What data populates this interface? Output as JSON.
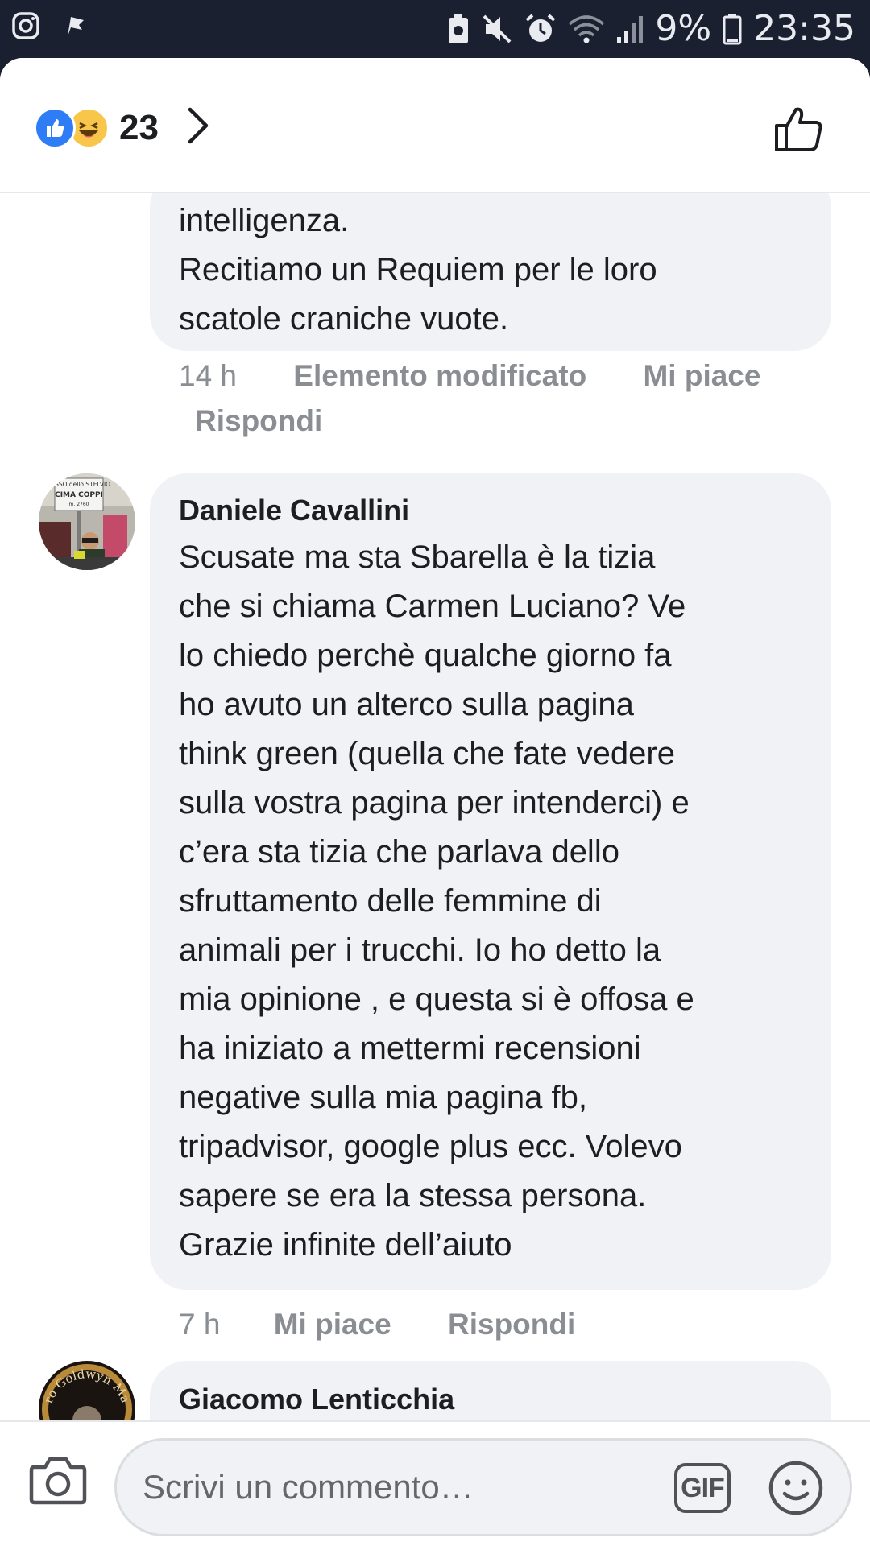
{
  "status_bar": {
    "battery": "9%",
    "time": "23:35"
  },
  "header": {
    "reaction_count": "23"
  },
  "comments": [
    {
      "text": "intelligenza.\nRecitiamo un Requiem per le loro\nscatole craniche vuote.",
      "time": "14 h",
      "edited_label": "Elemento modificato",
      "like_label": "Mi piace",
      "reply_label": "Rispondi"
    },
    {
      "author": "Daniele Cavallini",
      "text": "Scusate ma sta Sbarella è la tizia\nche si chiama Carmen Luciano? Ve\nlo chiedo perchè qualche giorno fa\nho avuto un alterco sulla pagina\nthink green (quella che fate vedere\nsulla vostra pagina per intenderci) e\nc’era sta tizia che parlava dello\nsfruttamento delle femmine di\nanimali per i trucchi. Io ho detto la\nmia opinione , e questa si è offosa e\nha iniziato a mettermi recensioni\nnegative sulla mia pagina fb,\ntripadvisor, google plus ecc. Volevo\nsapere se era la stessa persona.\nGrazie infinite dell’aiuto",
      "time": "7 h",
      "like_label": "Mi piace",
      "reply_label": "Rispondi",
      "avatar_sign_lines": [
        "PASSO dello STELVIO",
        "CIMA COPPI",
        "m. 2760"
      ]
    },
    {
      "author": "Giacomo Lenticchia",
      "avatar_text": "ro Goldwyn May"
    }
  ],
  "composer": {
    "placeholder": "Scrivi un commento…",
    "gif_label": "GIF"
  },
  "icons": [
    "instagram-icon",
    "flag-icon",
    "battery-saver-icon",
    "mute-icon",
    "alarm-icon",
    "wifi-icon",
    "signal-icon",
    "battery-icon",
    "like-reaction-icon",
    "haha-reaction-icon",
    "chevron-right-icon",
    "thumbs-up-icon",
    "camera-icon",
    "smiley-icon"
  ],
  "colors": {
    "status_bar": "#1b2030",
    "bubble": "#f0f2f5",
    "like_blue": "#2f7df6",
    "haha_yellow": "#f7c64a",
    "meta_gray": "#8a8d91"
  }
}
